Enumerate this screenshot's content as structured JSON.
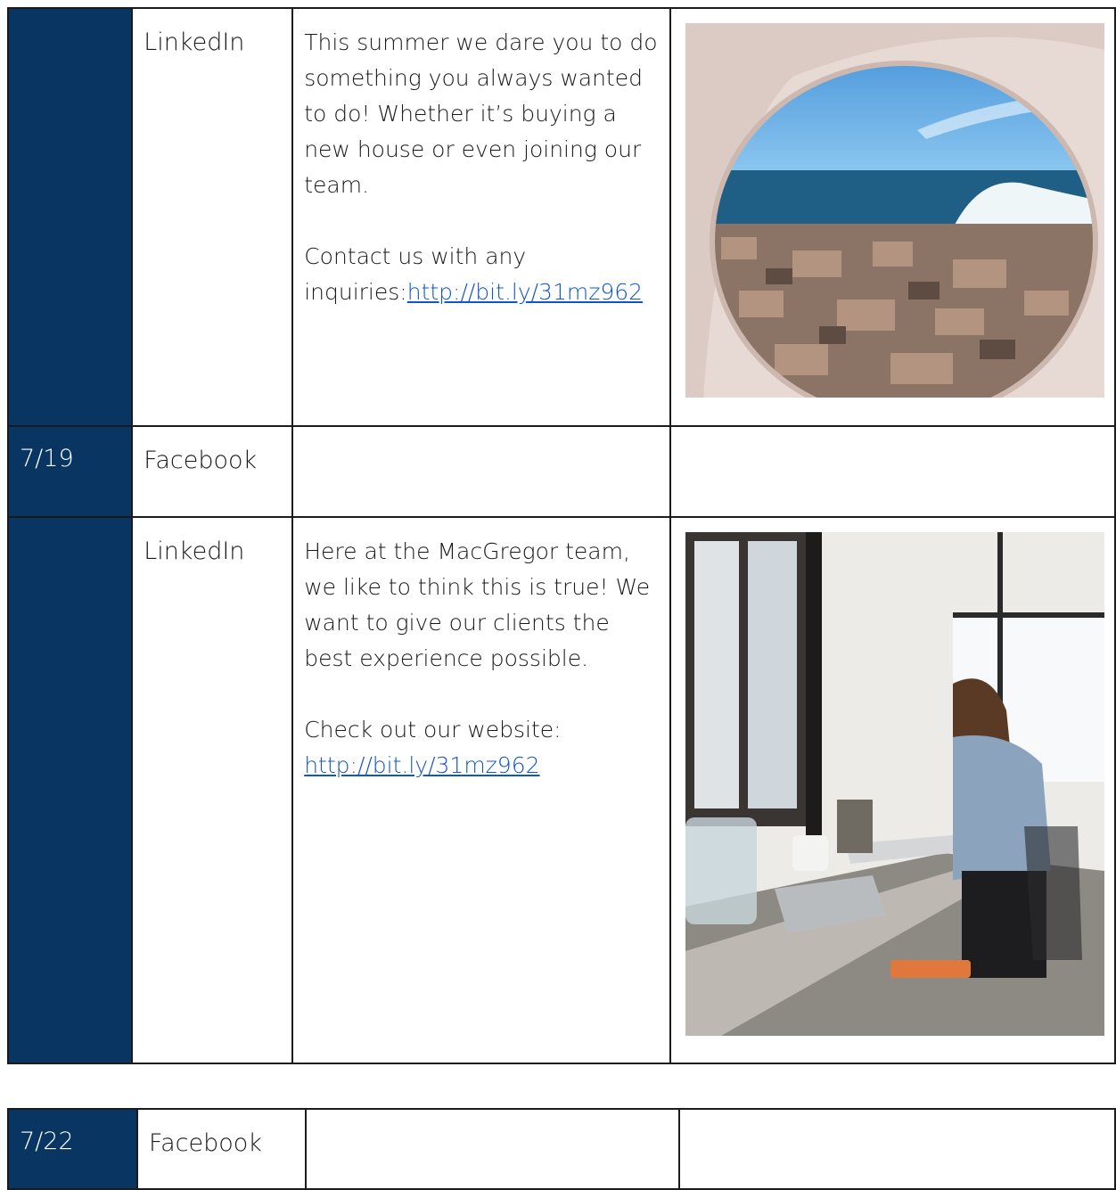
{
  "table1": {
    "rows": [
      {
        "date": "",
        "platform": "LinkedIn",
        "paragraphs": [
          "This summer we dare you to do something you always wanted to do! Whether it’s buying a new house or even joining our team."
        ],
        "last_prefix": "Contact us with any inquiries:",
        "link": "http://bit.ly/31mz962",
        "image": "beach-rocks-photo"
      },
      {
        "date": "7/19",
        "platform": "Facebook"
      },
      {
        "date": "",
        "platform": "LinkedIn",
        "paragraphs": [
          "Here at the MacGregor team, we like to think this is true! We want to give our clients the best experience possible."
        ],
        "last_prefix": "Check out our website:",
        "link": "http://bit.ly/31mz962",
        "image": "woman-laptop-cafe-photo"
      }
    ]
  },
  "table2": {
    "rows": [
      {
        "date": "7/22",
        "platform": "Facebook"
      }
    ]
  },
  "colors": {
    "date_column": "#083561",
    "link": "#1155cc",
    "border": "#1b1b1b"
  }
}
